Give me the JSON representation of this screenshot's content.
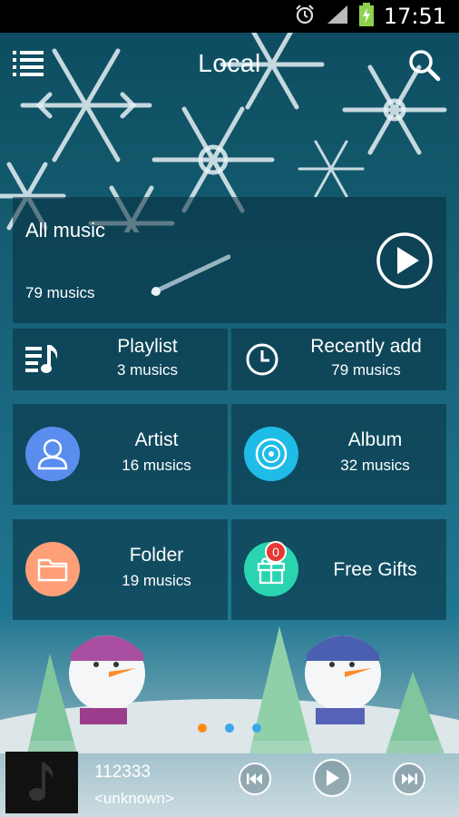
{
  "status_bar": {
    "time": "17:51",
    "icons": [
      "alarm-icon",
      "signal-icon",
      "battery-charging-icon"
    ]
  },
  "header": {
    "title": "Local",
    "menu_icon": "list-menu-icon",
    "search_icon": "search-icon"
  },
  "all_music": {
    "label": "All music",
    "count": "79 musics",
    "icon": "play-circle-icon"
  },
  "playlist": {
    "label": "Playlist",
    "count": "3 musics",
    "icon": "playlist-icon"
  },
  "recently_add": {
    "label": "Recently add",
    "count": "79 musics",
    "icon": "clock-icon"
  },
  "artist": {
    "label": "Artist",
    "count": "16 musics",
    "icon": "person-icon",
    "color": "#5b8def"
  },
  "album": {
    "label": "Album",
    "count": "32 musics",
    "icon": "disc-icon",
    "color": "#1fbce8"
  },
  "folder": {
    "label": "Folder",
    "count": "19 musics",
    "icon": "folder-icon",
    "color": "#ff9f78"
  },
  "free_gifts": {
    "label": "Free Gifts",
    "badge": "0",
    "icon": "gift-icon",
    "color": "#2bd4b0"
  },
  "pager": {
    "dot_colors": [
      "#ff8c1a",
      "#3aa8e8",
      "#3aa8e8"
    ]
  },
  "player": {
    "title": "112333",
    "artist": "<unknown>",
    "controls": [
      "previous-icon",
      "play-icon",
      "next-icon"
    ]
  }
}
